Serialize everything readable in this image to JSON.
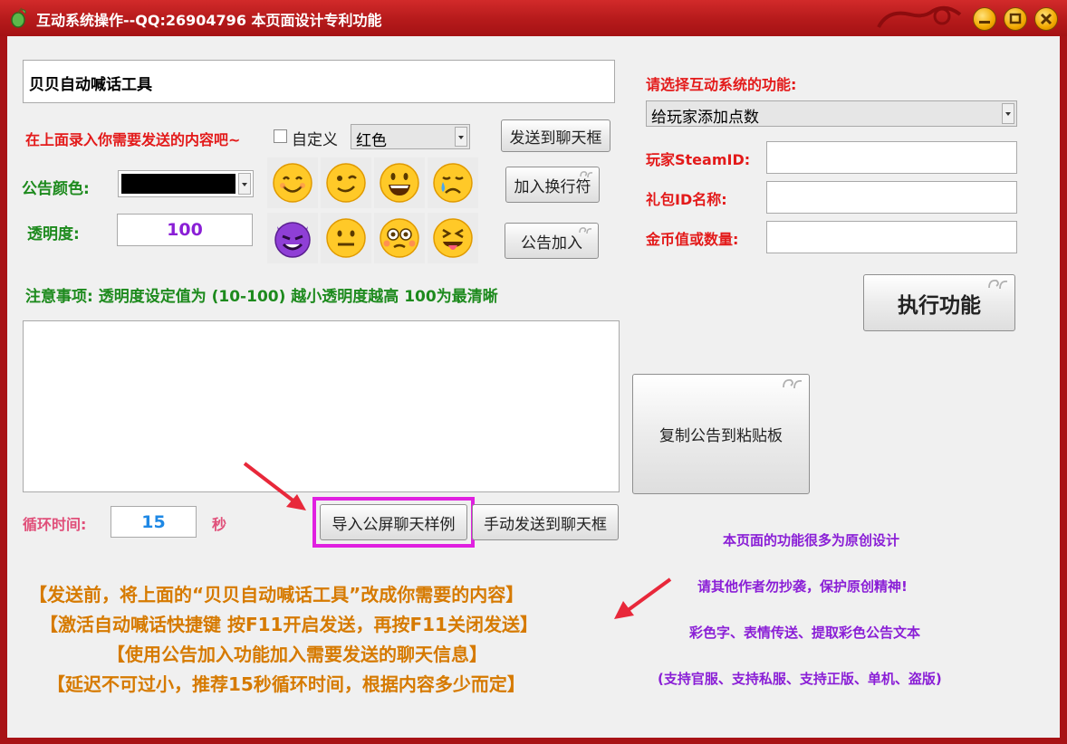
{
  "window": {
    "title": "互动系统操作--QQ:26904796 本页面设计专利功能"
  },
  "left": {
    "message_input_value": "贝贝自动喊话工具",
    "hint_label": "在上面录入你需要发送的内容吧~",
    "custom_checkbox_label": "自定义",
    "color_select_value": "红色",
    "send_to_chat_button": "发送到聊天框",
    "announce_color_label": "公告颜色:",
    "add_newline_button": "加入换行符",
    "opacity_label": "透明度:",
    "opacity_value": "100",
    "announce_add_button": "公告加入",
    "notice_text": "注意事项: 透明度设定值为 (10-100) 越小透明度越高 100为最清晰",
    "loop_time_label": "循环时间:",
    "loop_time_value": "15",
    "seconds_label": "秒",
    "import_example_button": "导入公屏聊天样例",
    "manual_send_button": "手动发送到聊天框",
    "instructions": [
      "【发送前，将上面的“贝贝自动喊话工具”改成你需要的内容】",
      "【激活自动喊话快捷键 按F11开启发送，再按F11关闭发送】",
      "【使用公告加入功能加入需要发送的聊天信息】",
      "【延迟不可过小，推荐15秒循环时间，根据内容多少而定】"
    ]
  },
  "right": {
    "select_function_label": "请选择互动系统的功能:",
    "function_select_value": "给玩家添加点数",
    "steamid_label": "玩家SteamID:",
    "gift_id_label": "礼包ID名称:",
    "coin_label": "金币值或数量:",
    "execute_button": "执行功能",
    "copy_button": "复制公告到粘贴板",
    "info_lines": [
      "本页面的功能很多为原创设计",
      "请其他作者勿抄袭，保护原创精神!",
      "彩色字、表情传送、提取彩色公告文本",
      "(支持官服、支持私服、支持正版、单机、盗版)"
    ]
  },
  "colors": {
    "title_bar": "#b51a1b",
    "accent_red": "#e31a1a",
    "accent_green": "#1d8a1d",
    "accent_purple": "#8a1fd6",
    "accent_orange": "#d67a00",
    "highlight_magenta": "#e020e0"
  },
  "emojis": [
    "smiling-face",
    "winking-face",
    "grinning-face",
    "crying-face",
    "smiling-devil",
    "neutral-face",
    "flushed-face",
    "tongue-out-face"
  ]
}
